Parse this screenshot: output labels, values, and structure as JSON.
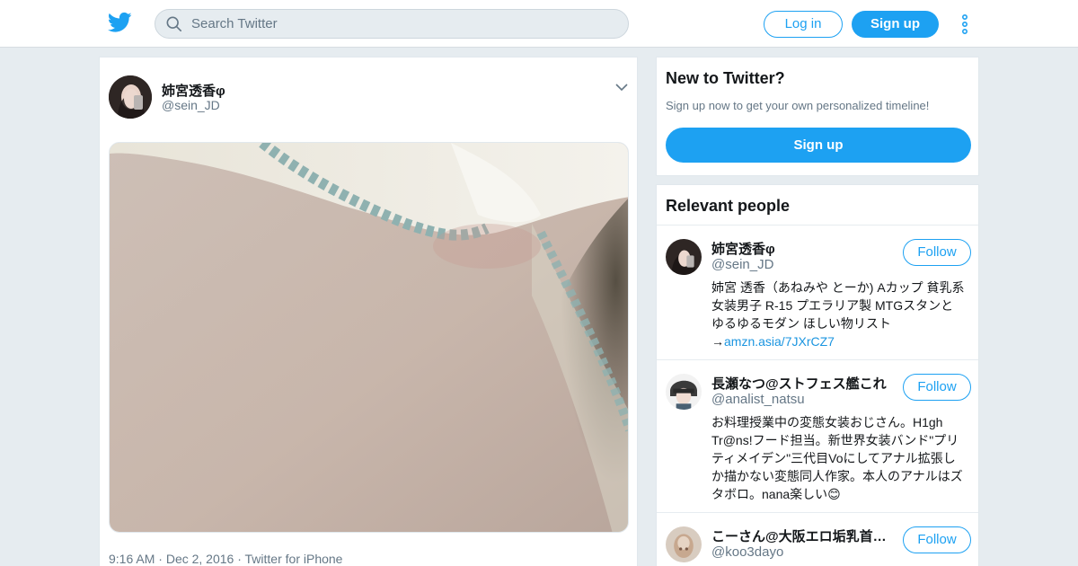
{
  "header": {
    "search_placeholder": "Search Twitter",
    "login_label": "Log in",
    "signup_label": "Sign up"
  },
  "tweet": {
    "author_name": "姉宮透香φ",
    "author_handle": "@sein_JD",
    "time": "9:16 AM",
    "date": "Dec 2, 2016",
    "source": "Twitter for iPhone"
  },
  "sidebar": {
    "new_to_twitter": {
      "title": "New to Twitter?",
      "subtitle": "Sign up now to get your own personalized timeline!",
      "button_label": "Sign up"
    },
    "relevant_people": {
      "title": "Relevant people",
      "people": [
        {
          "name": "姉宮透香φ",
          "handle": "@sein_JD",
          "follow_label": "Follow",
          "bio": "姉宮 透香（あねみや とーか) Aカップ 貧乳系女装男子 R-15 プエラリア製 MTGスタンとゆるゆるモダン ほしい物リスト→",
          "bio_link": "amzn.asia/7JXrCZ7"
        },
        {
          "name": "長瀬なつ@ストフェス艦これ",
          "handle": "@analist_natsu",
          "follow_label": "Follow",
          "bio": "お料理授業中の変態女装おじさん。H1gh Tr@ns!フード担当。新世界女装バンド\"プリティメイデン\"三代目Voにしてアナル拡張しか描かない変態同人作家。本人のアナルはズタボロ。nana楽しい😊"
        },
        {
          "name": "こーさん@大阪エロ垢乳首開発",
          "handle": "@koo3dayo",
          "follow_label": "Follow"
        }
      ]
    }
  },
  "colors": {
    "accent": "#1da1f2",
    "background": "#e6ecf0",
    "secondary_text": "#657786"
  },
  "icons": [
    "twitter-bird-icon",
    "search-icon",
    "more-vertical-icon",
    "chevron-down-icon"
  ]
}
